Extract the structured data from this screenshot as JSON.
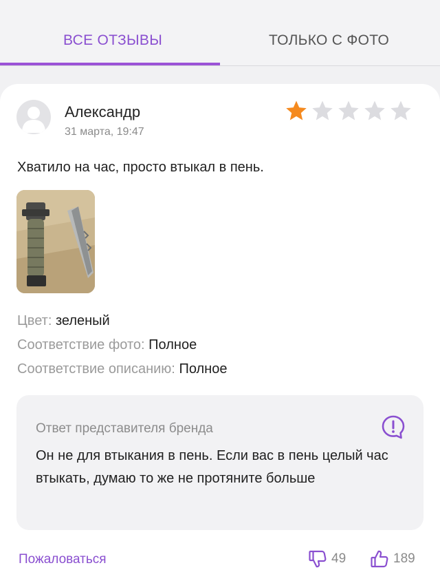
{
  "tabs": {
    "all_label": "ВСЕ ОТЗЫВЫ",
    "photo_label": "ТОЛЬКО С ФОТО"
  },
  "review": {
    "author": "Александр",
    "date": "31 марта, 19:47",
    "rating": 1,
    "rating_max": 5,
    "text": "Хватило на час, просто втыкал в пень.",
    "photo_icon": "knife-photo",
    "attributes": [
      {
        "key": "Цвет:",
        "value": "зеленый"
      },
      {
        "key": "Соответствие фото:",
        "value": "Полное"
      },
      {
        "key": "Соответствие описанию:",
        "value": "Полное"
      }
    ]
  },
  "reply": {
    "title": "Ответ представителя бренда",
    "text": "Он не для втыкания в пень. Если вас в пень целый час втыкать, думаю то же не протяните больше"
  },
  "footer": {
    "complain_label": "Пожаловаться",
    "dislikes": "49",
    "likes": "189"
  },
  "colors": {
    "accent": "#8a4fd0",
    "star_filled": "#f58a1f",
    "star_empty": "#dcdce0"
  }
}
